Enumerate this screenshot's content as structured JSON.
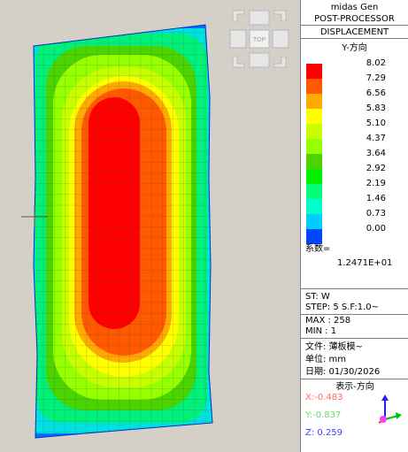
{
  "legend": {
    "program": "midas Gen",
    "mode": "POST-PROCESSOR",
    "result_type": "DISPLACEMENT",
    "component": "Y-方向",
    "colors": [
      "#ff0000",
      "#ff5a00",
      "#ffaa00",
      "#ffff00",
      "#c8ff00",
      "#96ff00",
      "#4bd400",
      "#00f000",
      "#00ff7a",
      "#00ffcc",
      "#00ccff",
      "#0046ff"
    ],
    "values": [
      "8.02",
      "7.29",
      "6.56",
      "5.83",
      "5.10",
      "4.37",
      "3.64",
      "2.92",
      "2.19",
      "1.46",
      "0.73",
      "0.00"
    ],
    "factor_label": "系数=",
    "factor_value": "1.2471E+01",
    "st": "ST: W",
    "step": "STEP: 5 S.F:1.0~",
    "max": "MAX : 258",
    "min": "MIN : 1",
    "file": "文件: 薄板模~",
    "unit": "单位: mm",
    "date": "日期: 01/30/2026",
    "direction_title": "表示-方向",
    "x": "X:-0.483",
    "y": "Y:-0.837",
    "z": "Z: 0.259",
    "x_color": "#ff6666",
    "y_color": "#66dd66",
    "z_color": "#4040ff"
  },
  "viewcube": {
    "top_label": "TOP"
  }
}
